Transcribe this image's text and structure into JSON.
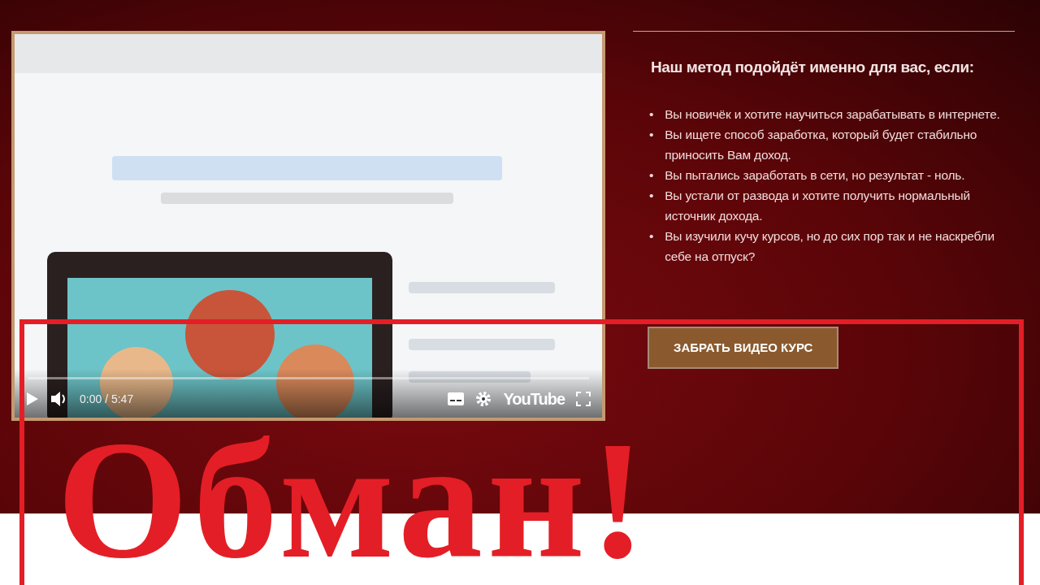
{
  "video": {
    "time": "0:00 / 5:47",
    "brand": "YouTube"
  },
  "panel": {
    "heading": "Наш метод подойдёт именно для вас, если:",
    "items": [
      {
        "bullet": "•",
        "text": "Вы новичёк и хотите научиться зарабатывать в интернете."
      },
      {
        "bullet": "•",
        "text": "Вы ищете способ заработка, который будет стабильно приносить Вам доход."
      },
      {
        "bullet": "•",
        "text": "Вы пытались заработать в сети, но результат - ноль."
      },
      {
        "bullet": "•",
        "text": "Вы устали от развода и хотите получить нормальный источник дохода."
      },
      {
        "bullet": "•",
        "text": "Вы изучили кучу курсов, но до сих пор так и не наскребли себе на отпуск?"
      }
    ],
    "button": "ЗАБРАТЬ ВИДЕО КУРС"
  },
  "stamp": {
    "text": "Обман!"
  }
}
